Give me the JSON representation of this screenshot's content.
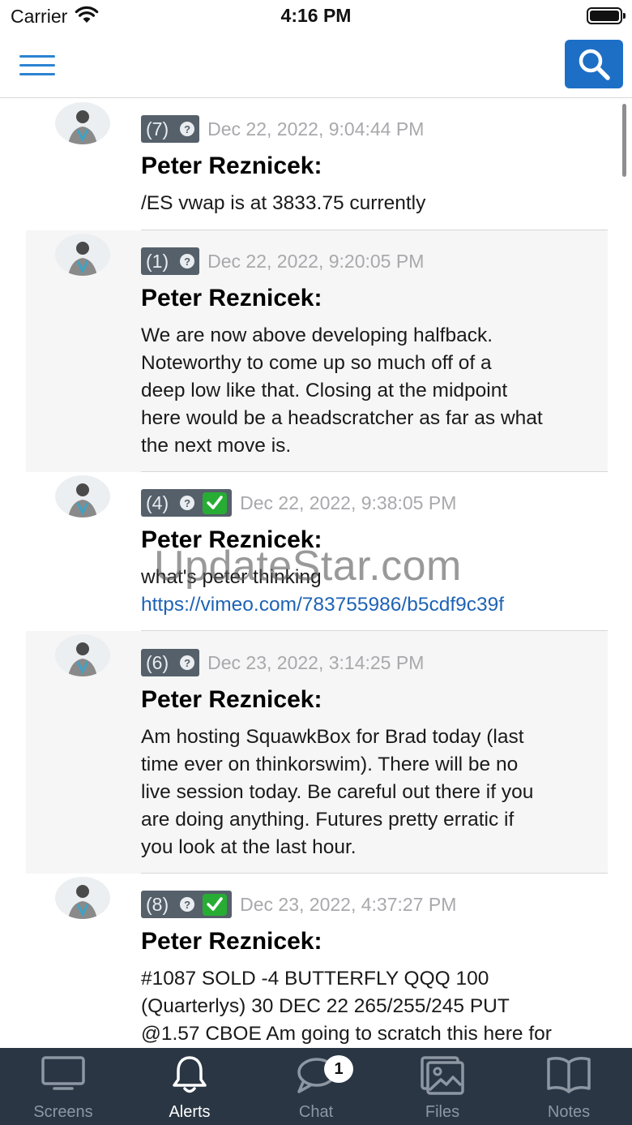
{
  "status_bar": {
    "carrier": "Carrier",
    "time": "4:16 PM"
  },
  "nav": {
    "menu_icon": "hamburger-icon",
    "search_icon": "search-icon",
    "accent": "#1d6fc6"
  },
  "messages": [
    {
      "count": "(7)",
      "checked": false,
      "date": "Dec 22, 2022, 9:04:44 PM",
      "author": "Peter Reznicek:",
      "lines": [
        "/ES vwap is at 3833.75 currently"
      ]
    },
    {
      "count": "(1)",
      "checked": false,
      "date": "Dec 22, 2022, 9:20:05 PM",
      "author": "Peter Reznicek:",
      "lines": [
        "We are now above developing halfback.",
        "Noteworthy to come up so much off of a",
        "deep low like that. Closing at the midpoint",
        "here would be a headscratcher as far as what",
        "the next move is."
      ]
    },
    {
      "count": "(4)",
      "checked": true,
      "date": "Dec 22, 2022, 9:38:05 PM",
      "author": "Peter Reznicek:",
      "lines": [
        "what's peter thinking"
      ],
      "link": "https://vimeo.com/783755986/b5cdf9c39f"
    },
    {
      "count": "(6)",
      "checked": false,
      "date": "Dec 23, 2022, 3:14:25 PM",
      "author": "Peter Reznicek:",
      "lines": [
        "Am hosting SquawkBox for Brad today (last",
        "time ever on thinkorswim). There will be no",
        "live session today. Be careful out there if you",
        "are doing anything. Futures pretty erratic if",
        "you look at the last hour."
      ]
    },
    {
      "count": "(8)",
      "checked": true,
      "date": "Dec 23, 2022, 4:37:27 PM",
      "author": "Peter Reznicek:",
      "lines": [
        "#1087 SOLD -4 BUTTERFLY QQQ 100",
        "(Quarterlys) 30 DEC 22 265/255/245 PUT",
        "@1.57 CBOE Am going to scratch this here for"
      ]
    }
  ],
  "watermark": "UpdateStar.com",
  "tabs": [
    {
      "label": "Screens",
      "icon": "monitor-icon",
      "active": false
    },
    {
      "label": "Alerts",
      "icon": "bell-icon",
      "active": true
    },
    {
      "label": "Chat",
      "icon": "chat-bubbles-icon",
      "active": false,
      "badge": "1"
    },
    {
      "label": "Files",
      "icon": "images-icon",
      "active": false
    },
    {
      "label": "Notes",
      "icon": "book-icon",
      "active": false
    }
  ],
  "colors": {
    "tabbar_bg": "#2a3644",
    "check_green": "#27ad34",
    "badge_bg": "#55606a",
    "link": "#1e63b5"
  }
}
